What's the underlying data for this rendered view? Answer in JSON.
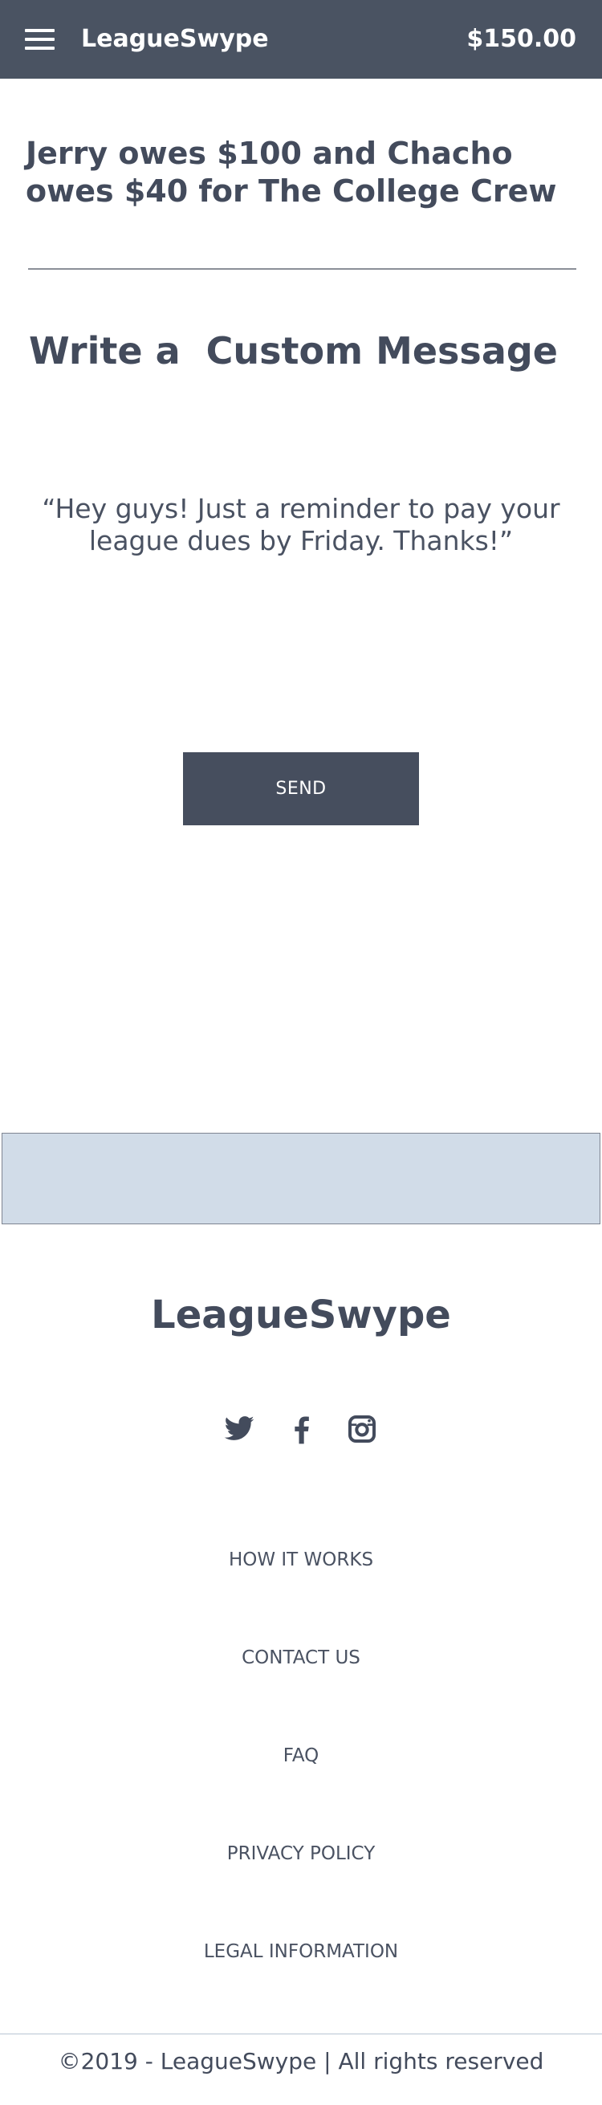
{
  "header": {
    "brand": "LeagueSwype",
    "balance": "$150.00",
    "menu_icon": "hamburger-menu-icon"
  },
  "main": {
    "title": "Jerry owes $100 and Chacho owes $40 for The College Crew",
    "custom_heading": "Write a  Custom Message",
    "message": "“Hey guys! Just a reminder to pay your league dues by Friday. Thanks!”",
    "send_label": "SEND"
  },
  "footer": {
    "brand": "LeagueSwype",
    "social": [
      {
        "icon": "twitter-icon"
      },
      {
        "icon": "facebook-icon"
      },
      {
        "icon": "instagram-icon"
      }
    ],
    "links": [
      {
        "label": "HOW IT WORKS"
      },
      {
        "label": "CONTACT US"
      },
      {
        "label": "FAQ"
      },
      {
        "label": "PRIVACY POLICY"
      },
      {
        "label": "LEGAL INFORMATION"
      }
    ],
    "copyright": "©2019 - LeagueSwype | All rights reserved"
  },
  "colors": {
    "header_bg": "#4a5362",
    "text": "#434b5c",
    "button_bg": "#464e5e",
    "banner_bg": "#d1dce8"
  }
}
